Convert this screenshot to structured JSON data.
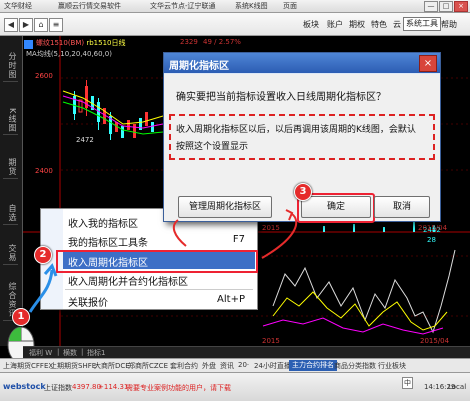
{
  "window": {
    "title_segments": [
      "文华财经",
      "赢顺云行情交易软件",
      "文华云节点-辽宁联通",
      "系统K线图",
      "页面"
    ],
    "buttons": [
      "—",
      "□",
      "×"
    ]
  },
  "menubar": {
    "items": [
      "板块",
      "账户",
      "期权",
      "特色",
      "云",
      "系统工具",
      "帮助"
    ]
  },
  "left_tabs": [
    "分时图",
    "K线图",
    "期货",
    "自选",
    "交易",
    "综合资讯"
  ],
  "chart": {
    "stock_title": "螺纹1510(BM)",
    "stock_title_tail": "rb1510日线",
    "ma_label": "MA均线(5,10,20,40,60,0)",
    "price_2600": "2600",
    "price_2400": "2400",
    "high_2329": "2329",
    "low_2472": "2472",
    "change": "49 / 2.57%",
    "x_2015": "2015",
    "x_201504": "2015/04",
    "x_2015b": "2015",
    "x_201504b": "2015/04",
    "val_2482": "2482",
    "val_28": "28"
  },
  "tabs_row": [
    "福利 W",
    "|",
    "横数",
    "|",
    "指标1"
  ],
  "context_menu": {
    "items": [
      {
        "label": "收入我的指标区",
        "shortcut": ""
      },
      {
        "label": "我的指标区工具条",
        "shortcut": "F7"
      },
      {
        "label": "收入周期化指标区",
        "shortcut": ""
      },
      {
        "label": "收入周期化并合约化指标区",
        "shortcut": ""
      },
      {
        "label": "关联报价",
        "shortcut": "Alt+P"
      }
    ]
  },
  "dialog": {
    "title": "周期化指标区",
    "question": "确实要把当前指标设置收入日线周期化指标区？",
    "note_line1": "收入周期化指标区以后，以后再调用该周期的K线图，会默认",
    "note_line2": "按照这个设置显示",
    "manage_button": "管理周期化指标区",
    "ok_button": "确定",
    "cancel_button": "取消",
    "close_glyph": "×"
  },
  "badges": [
    "1",
    "2",
    "3"
  ],
  "market_strip": [
    "上海期货CFFEX",
    "上期期货SHFE",
    "大商所DCE",
    "郑商所CZCE",
    "套利合约",
    "外盘",
    "资讯",
    "20·",
    "24小时直播",
    "主力合约排名",
    "商品分类指数",
    "行业板块"
  ],
  "statusbar": {
    "logo": "webstock",
    "index_label": "上证指数",
    "index_value": "4397.80",
    "index_change": "+114.31",
    "notice": "需要专业案例功能的用户，请下载",
    "ime_glyph": "中",
    "clock": "14:16:29",
    "clock_tag": "Local"
  },
  "colors": {
    "accent_red": "#e52b2b",
    "selection_blue": "#3d6fc6",
    "dialog_title_blue": "#2c5db3"
  }
}
